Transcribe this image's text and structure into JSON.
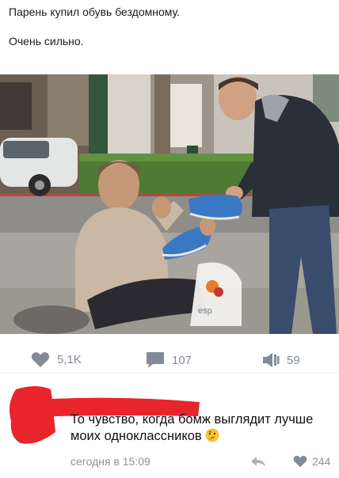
{
  "post": {
    "line1": "Парень купил обувь бездомному.",
    "line2": "Очень сильно."
  },
  "actions": {
    "likes": "5,1K",
    "comments": "107",
    "reposts": "59"
  },
  "comment": {
    "text": "То чувство, когда бомж выглядит лучше моих одноклассников",
    "emoji": "thinking-face-emoji",
    "timestamp": "сегодня в 15:09",
    "likes": "244"
  },
  "colors": {
    "icon_gray": "#828b96",
    "redaction_red": "#e8252b"
  },
  "icons": [
    "heart-icon",
    "comment-icon",
    "repost-icon",
    "reply-icon",
    "heart-icon-small"
  ]
}
